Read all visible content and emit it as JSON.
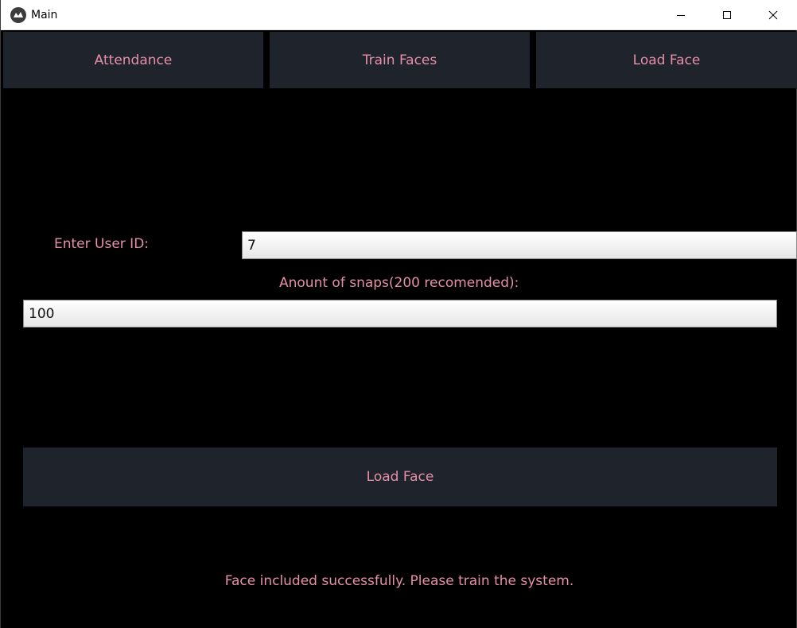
{
  "window": {
    "title": "Main",
    "controls": [
      "minimize-icon",
      "maximize-icon",
      "close-icon"
    ]
  },
  "tabs": [
    {
      "label": "Attendance"
    },
    {
      "label": "Train Faces"
    },
    {
      "label": "Load Face"
    }
  ],
  "form": {
    "user_id_label": "Enter User ID:",
    "user_id_value": "7",
    "snaps_label": "Anount of snaps(200 recomended):",
    "snaps_value": "100"
  },
  "action": {
    "load_face_label": "Load Face"
  },
  "status": {
    "message": "Face included successfully. Please train the system."
  },
  "colors": {
    "background": "#000000",
    "button_bg": "#1f232b",
    "accent_text": "#e58fa8",
    "titlebar_bg": "#ffffff"
  }
}
